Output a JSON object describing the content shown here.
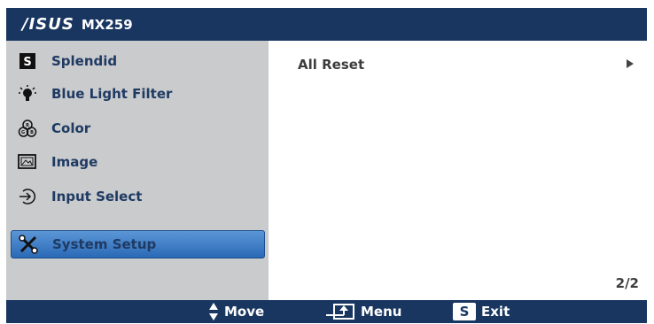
{
  "header": {
    "brand": "/ISUS",
    "model": "MX259"
  },
  "sidebar": {
    "items": [
      {
        "label": "Splendid",
        "icon": "splendid-s-icon",
        "selected": false
      },
      {
        "label": "Blue Light Filter",
        "icon": "light-bulb-icon",
        "selected": false
      },
      {
        "label": "Color",
        "icon": "rgb-circles-icon",
        "selected": false
      },
      {
        "label": "Image",
        "icon": "image-icon",
        "selected": false
      },
      {
        "label": "Input Select",
        "icon": "input-arrow-icon",
        "selected": false
      },
      {
        "label": "System Setup",
        "icon": "tools-icon",
        "selected": true
      }
    ]
  },
  "main": {
    "option_label": "All Reset",
    "option_icon": "triangle-right-icon",
    "page_indicator": "2/2"
  },
  "footer": {
    "move_label": "Move",
    "menu_label": "Menu",
    "exit_label": "Exit",
    "exit_key": "S"
  },
  "colors": {
    "header_bg": "#183660",
    "sidebar_bg": "#c9cbcc",
    "selected_bg": "#3d7bc4",
    "text": "#1f3a63"
  }
}
